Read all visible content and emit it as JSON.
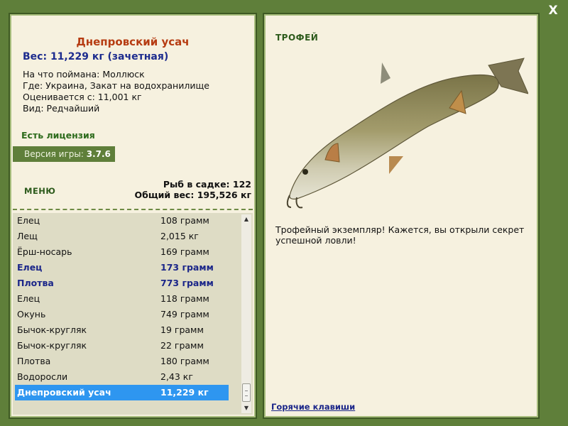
{
  "window": {
    "close_label": "X"
  },
  "fish_info": {
    "name": "Днепровский усач",
    "weight": "Вес: 11,229 кг (зачетная)",
    "caught_on": "На что поймана: Моллюск",
    "location": "Где: Украина, Закат на водохранилище",
    "rated_from": "Оценивается с: 11,001 кг",
    "rarity": "Вид: Редчайший"
  },
  "license": "Есть лицензия",
  "version": {
    "label": "Версия игры:",
    "value": "3.7.6"
  },
  "menu_label": "МЕНЮ",
  "stats": {
    "fish_count": "Рыб в садке: 122",
    "total_weight": "Общий вес: 195,526 кг"
  },
  "catch_list": [
    {
      "name": "Елец",
      "weight": "108 грамм",
      "style": "normal"
    },
    {
      "name": "Лещ",
      "weight": "2,015 кг",
      "style": "normal"
    },
    {
      "name": "Ёрш-носарь",
      "weight": "169 грамм",
      "style": "normal"
    },
    {
      "name": "Елец",
      "weight": "173 грамм",
      "style": "bold"
    },
    {
      "name": "Плотва",
      "weight": "773 грамм",
      "style": "bold"
    },
    {
      "name": "Елец",
      "weight": "118 грамм",
      "style": "normal"
    },
    {
      "name": "Окунь",
      "weight": "749 грамм",
      "style": "normal"
    },
    {
      "name": "Бычок-кругляк",
      "weight": "19 грамм",
      "style": "normal"
    },
    {
      "name": "Бычок-кругляк",
      "weight": "22 грамм",
      "style": "normal"
    },
    {
      "name": "Плотва",
      "weight": "180 грамм",
      "style": "normal"
    },
    {
      "name": "Водоросли",
      "weight": "2,43 кг",
      "style": "normal"
    },
    {
      "name": "Днепровский усач",
      "weight": "11,229 кг",
      "style": "selected"
    }
  ],
  "trophy": {
    "title": "ТРОФЕЙ",
    "description": "Трофейный экземпляр! Кажется, вы открыли секрет успешной ловли!",
    "hotkeys_link": "Горячие клавиши"
  },
  "colors": {
    "frame": "#5f7f3a",
    "panel": "#f6f1df",
    "fish_name": "#b63c12",
    "accent_blue": "#1b2689",
    "selection": "#2e96f0"
  },
  "icons": {
    "close": "close-icon",
    "scroll_up": "arrow-up-icon",
    "scroll_down": "arrow-down-icon",
    "fish": "barbel-fish-image"
  }
}
